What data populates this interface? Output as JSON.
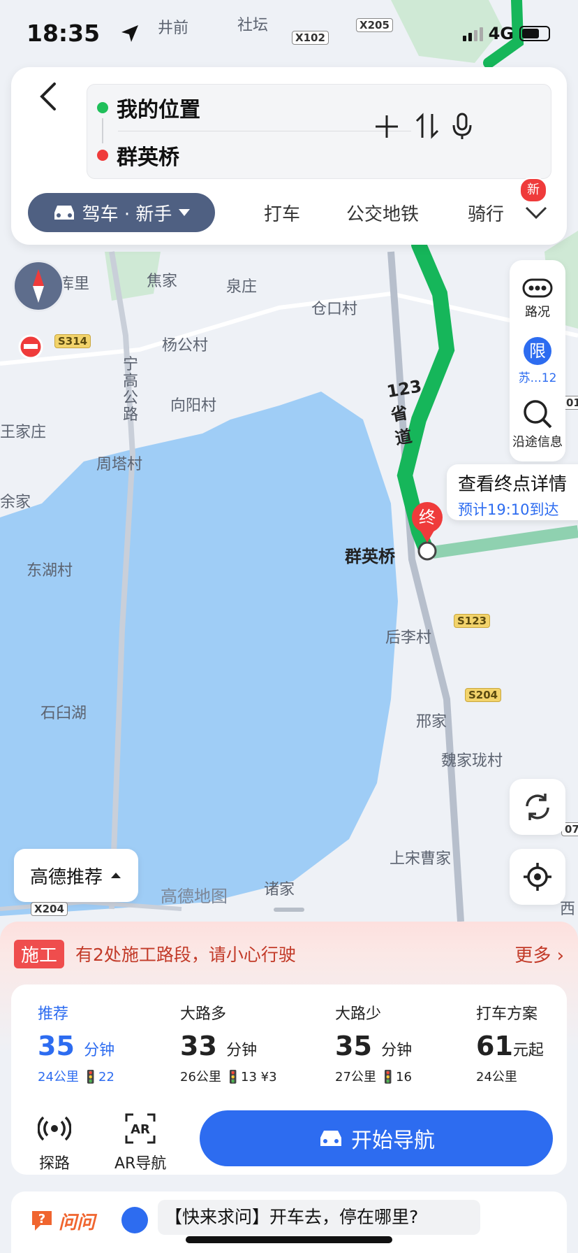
{
  "status_bar": {
    "time": "18:35",
    "network": "4G"
  },
  "route_search": {
    "origin": "我的位置",
    "destination": "群英桥"
  },
  "travel_modes": {
    "active": "驾车 · 新手",
    "others": [
      "打车",
      "公交地铁",
      "骑行"
    ],
    "new_badge": "新"
  },
  "map": {
    "labels": [
      "井前",
      "社坛",
      "水库里",
      "焦家",
      "泉庄",
      "仓口村",
      "杨公村",
      "宁高公路",
      "向阳村",
      "王家庄",
      "周塔村",
      "余家",
      "东湖村",
      "石臼湖",
      "后李村",
      "邢家",
      "魏家珑村",
      "上宋曹家",
      "诸家",
      "西"
    ],
    "road_badges": [
      "X102",
      "X205",
      "S314",
      "S123",
      "S204",
      "X204",
      "01",
      "07"
    ],
    "route_label": "123省道",
    "destination_name": "群英桥",
    "end_marker": "终",
    "watermark": "高德地图"
  },
  "map_tools": {
    "traffic": "路况",
    "limit_icon": "限",
    "limit_text": "苏...12",
    "along_route": "沿途信息"
  },
  "dest_callout": {
    "title": "查看终点详情",
    "eta": "预计19:10到达"
  },
  "route_pref": "高德推荐",
  "construction": {
    "tag": "施工",
    "message": "有2处施工路段，请小心行驶",
    "more": "更多 ›"
  },
  "routes": [
    {
      "name": "推荐",
      "minutes": "35",
      "unit": "分钟",
      "detail": "24公里 🚦22"
    },
    {
      "name": "大路多",
      "minutes": "33",
      "unit": "分钟",
      "detail": "26公里 🚦13 ¥3"
    },
    {
      "name": "大路少",
      "minutes": "35",
      "unit": "分钟",
      "detail": "27公里 🚦16"
    },
    {
      "name": "打车方案",
      "minutes": "61",
      "unit": "元起",
      "detail": "24公里"
    }
  ],
  "actions": {
    "explore": "探路",
    "ar_nav": "AR导航",
    "start": "开始导航"
  },
  "ask": {
    "brand": "问问",
    "question": "【快来求问】开车去，停在哪里?"
  },
  "colors": {
    "accent": "#2d6cf0",
    "route_green": "#16b65a",
    "water": "#9fcdf6",
    "warn": "#ef4d4d"
  }
}
